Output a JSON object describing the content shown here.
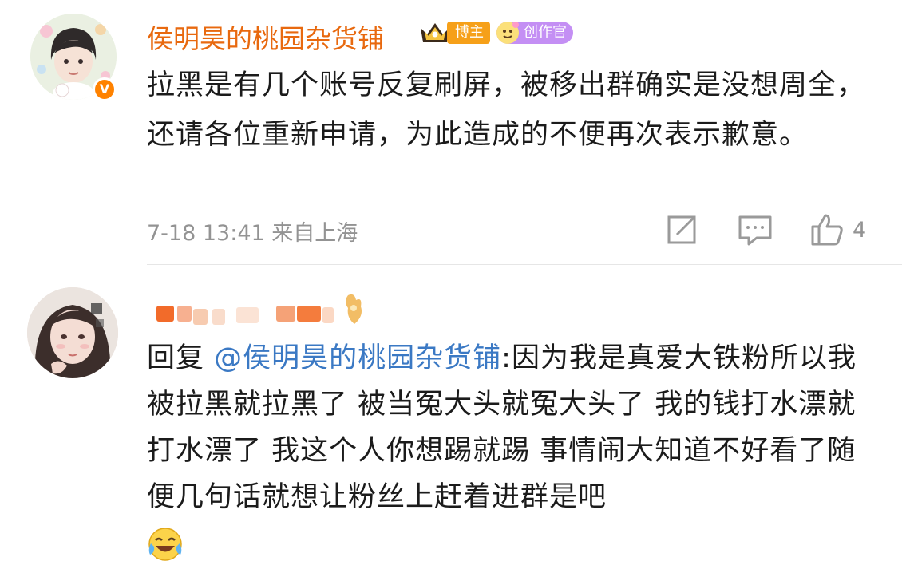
{
  "comments": [
    {
      "username": "侯明昊的桃园杂货铺",
      "verified_badge": "V",
      "badges": {
        "blogger": "博主",
        "creator": "创作官"
      },
      "text": "拉黑是有几个账号反复刷屏，被移出群确实是没想周全，还请各位重新申请，为此造成的不便再次表示歉意。",
      "time": "7-18 13:41",
      "location": "来自上海",
      "likes": "4",
      "icons": [
        "share-icon",
        "comment-icon",
        "like-icon"
      ]
    },
    {
      "username_blurred": true,
      "reply_prefix": "回复 ",
      "mention": "@侯明昊的桃园杂货铺",
      "text": ":因为我是真爱大铁粉所以我被拉黑就拉黑了 被当冤大头就冤大头了 我的钱打水漂就打水漂了 我这个人你想踢就踢 事情闹大知道不好看了随便几句话就想让粉丝上赶着进群是吧",
      "trailing_emoji": "laughing-crying-emoji"
    }
  ],
  "colors": {
    "username": "#e8690f",
    "mention": "#3b79c4",
    "meta": "#939393",
    "vip_orange": "#ff8200"
  }
}
